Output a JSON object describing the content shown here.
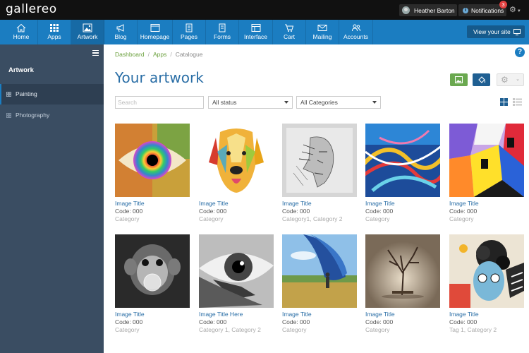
{
  "brand": {
    "logo": "gallereo"
  },
  "topbar": {
    "user_name": "Heather Barton",
    "notifications_label": "Notifications",
    "notifications_count": "3"
  },
  "nav": {
    "items": [
      {
        "label": "Home",
        "icon": "home-icon"
      },
      {
        "label": "Apps",
        "icon": "apps-grid-icon"
      },
      {
        "label": "Artwork",
        "icon": "image-icon",
        "active": true
      },
      {
        "label": "Blog",
        "icon": "megaphone-icon"
      },
      {
        "label": "Homepage",
        "icon": "browser-icon"
      },
      {
        "label": "Pages",
        "icon": "document-icon"
      },
      {
        "label": "Forms",
        "icon": "form-icon"
      },
      {
        "label": "Interface",
        "icon": "layout-icon"
      },
      {
        "label": "Cart",
        "icon": "cart-icon"
      },
      {
        "label": "Mailing",
        "icon": "mail-icon"
      },
      {
        "label": "Accounts",
        "icon": "users-icon"
      }
    ],
    "view_site_label": "View your site"
  },
  "sidebar": {
    "title": "Artwork",
    "items": [
      {
        "label": "Painting",
        "active": true
      },
      {
        "label": "Photography",
        "active": false
      }
    ]
  },
  "breadcrumb": [
    "Dashboard",
    "Apps",
    "Catalogue"
  ],
  "main": {
    "title": "Your artwork",
    "search_placeholder": "Search",
    "status_filter": "All status",
    "category_filter": "All Categories",
    "help_label": "?"
  },
  "colors": {
    "accent_blue": "#1b7dc1",
    "nav_active": "#176aa5",
    "sidebar_bg": "#3a4d62",
    "green_button": "#6aa84f",
    "link_blue": "#2a6ea6",
    "breadcrumb_green": "#6aa03c"
  },
  "gallery": [
    {
      "title": "Image Title",
      "code": "Code: 000",
      "category": "Category",
      "art": "colorful-eye"
    },
    {
      "title": "Image Title",
      "code": "Code: 000",
      "category": "Category",
      "art": "watercolor-dog"
    },
    {
      "title": "Image Title",
      "code": "Code: 000",
      "category": "Category1, Category 2",
      "art": "sketch-face"
    },
    {
      "title": "Image Title",
      "code": "Code: 000",
      "category": "Category",
      "art": "abstract-paint"
    },
    {
      "title": "Image Title",
      "code": "Code: 000",
      "category": "Category",
      "art": "geometric-city"
    },
    {
      "title": "Image Title",
      "code": "Code: 000",
      "category": "Category",
      "art": "monkey-bubble"
    },
    {
      "title": "Image Title Here",
      "code": "Code: 000",
      "category": "Category 1, Category 2",
      "art": "eye-closeup"
    },
    {
      "title": "Image Title",
      "code": "Code: 000",
      "category": "Category",
      "art": "surreal-landscape"
    },
    {
      "title": "Image Title",
      "code": "Code: 000",
      "category": "Category",
      "art": "lone-tree"
    },
    {
      "title": "Image Title",
      "code": "Code: 000",
      "category": "Tag 1, Category 2",
      "art": "pop-art-portrait"
    }
  ]
}
